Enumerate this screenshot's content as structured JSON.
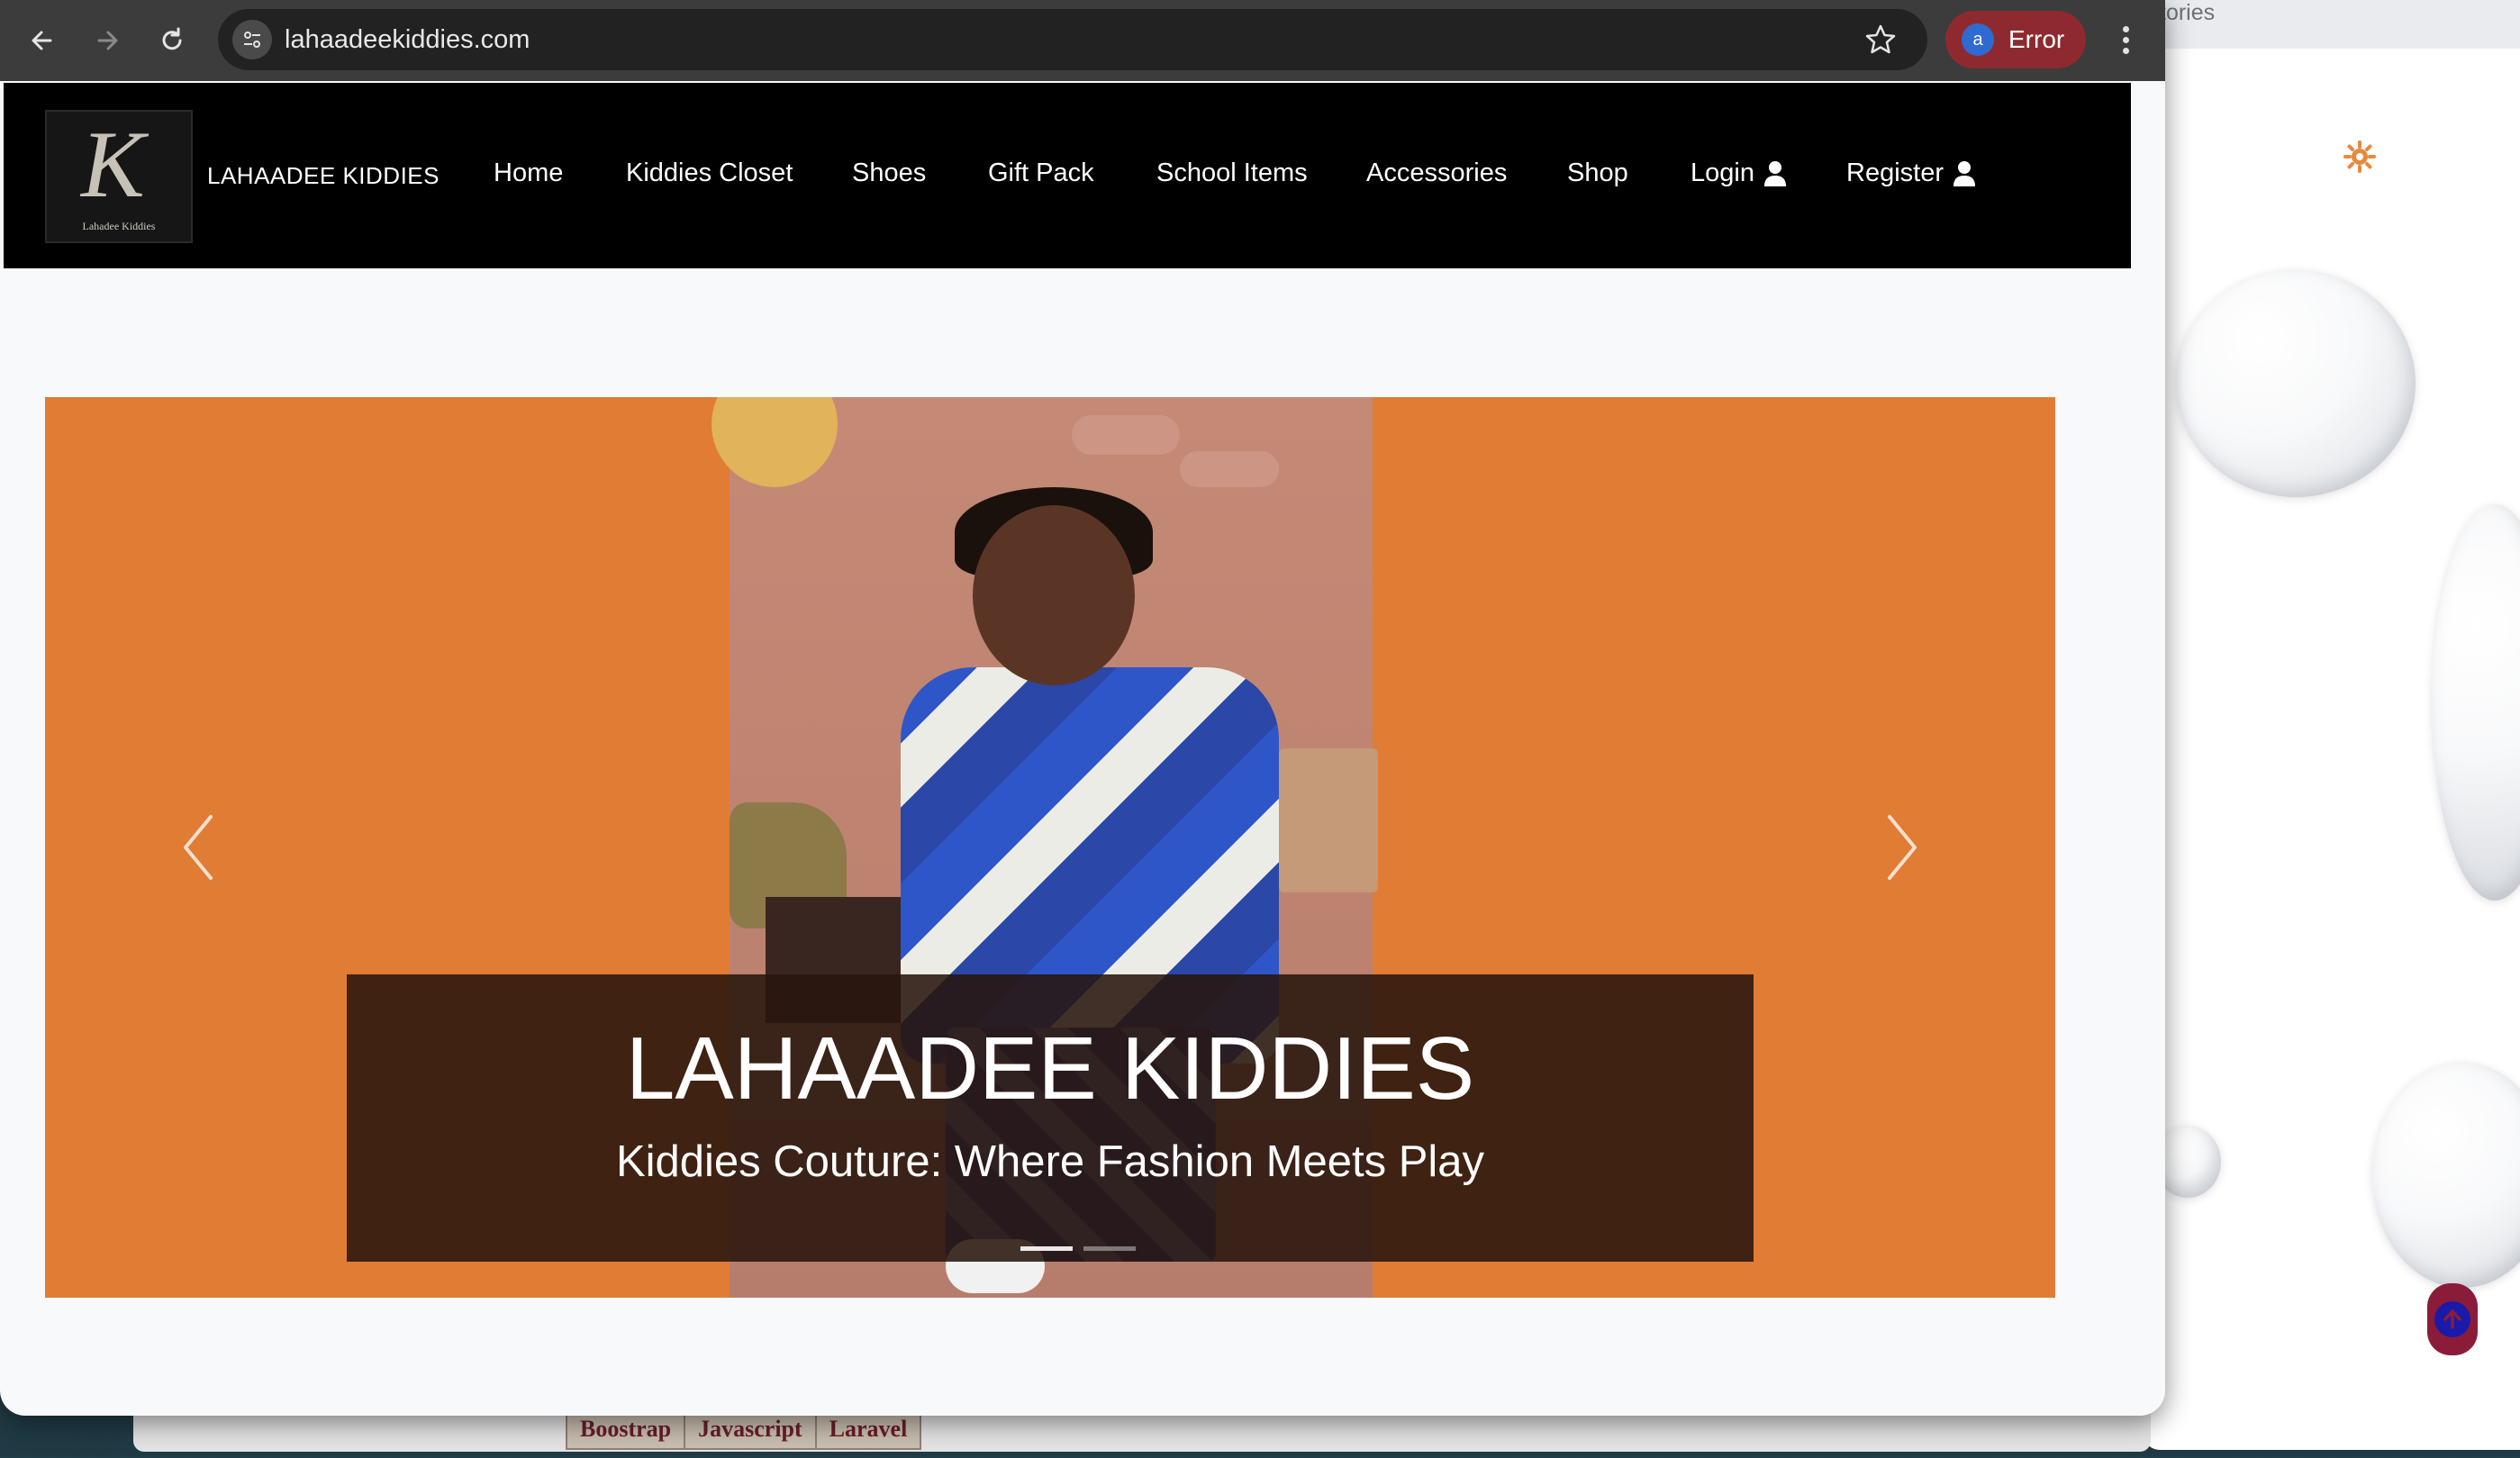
{
  "browser": {
    "url": "lahaadeekiddies.com",
    "profile_initial": "a",
    "profile_status": "Error"
  },
  "background_window": {
    "tab_text_fragment": "tories"
  },
  "behind_window": {
    "tabs": [
      "Boostrap",
      "Javascript",
      "Laravel"
    ]
  },
  "site": {
    "logo_letter": "K",
    "logo_tagline": "Lahadee Kiddies",
    "brand": "LAHAADEE KIDDIES",
    "nav": [
      {
        "label": "Home"
      },
      {
        "label": "Kiddies Closet"
      },
      {
        "label": "Shoes"
      },
      {
        "label": "Gift Pack"
      },
      {
        "label": "School Items"
      },
      {
        "label": "Accessories"
      },
      {
        "label": "Shop"
      },
      {
        "label": "Login"
      },
      {
        "label": "Register"
      }
    ]
  },
  "hero": {
    "title": "LAHAADEE KIDDIES",
    "subtitle": "Kiddies Couture: Where Fashion Meets Play",
    "slides_total": 2,
    "active_slide": 1
  },
  "colors": {
    "hero_orange": "#e17c34",
    "nav_black": "#000000",
    "profile_chip": "#8e2a2f",
    "scroll_top_bg": "#8a1c3a"
  }
}
